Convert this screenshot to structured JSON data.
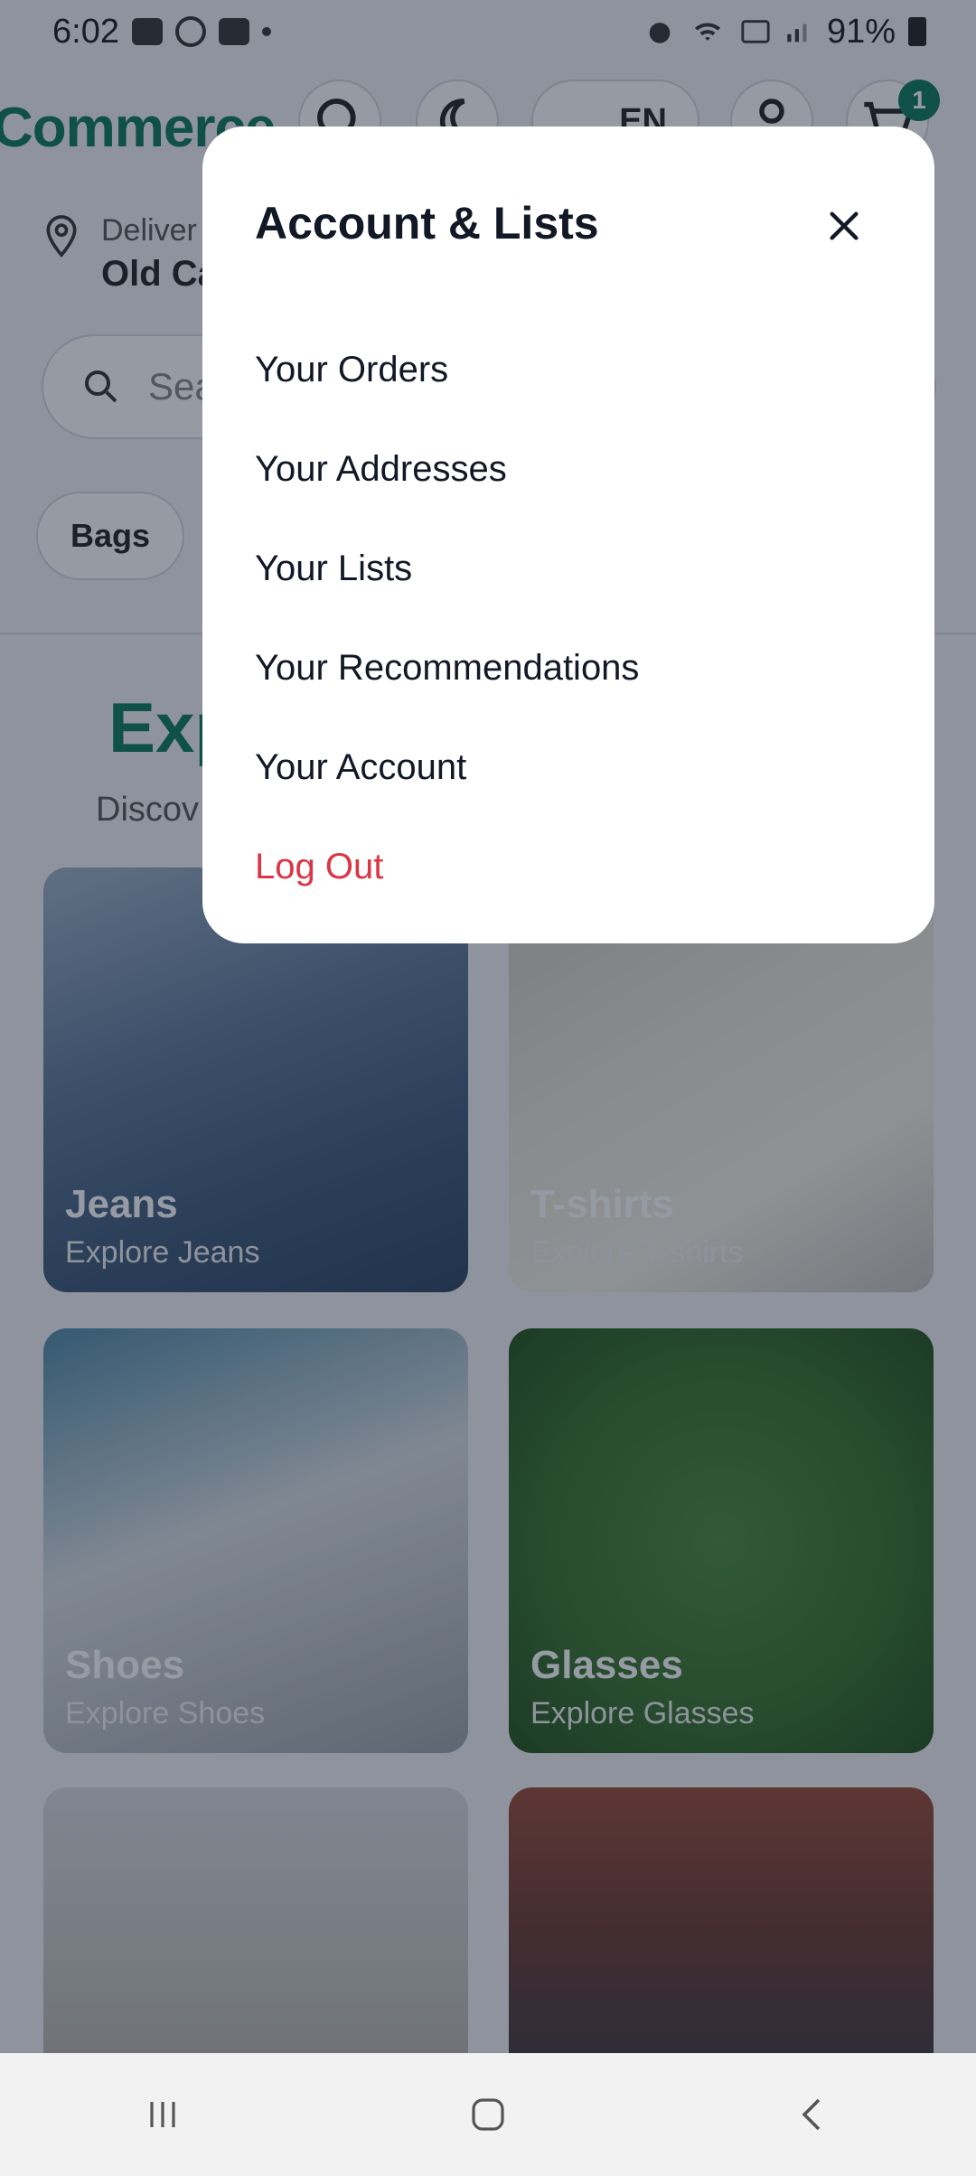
{
  "status_bar": {
    "time": "6:02",
    "battery": "91%",
    "icons": [
      "gallery-icon",
      "vpn-icon",
      "youtube-icon",
      "dot-icon",
      "alarm-icon",
      "wifi-icon",
      "volte-icon",
      "signal-icon",
      "battery-icon"
    ]
  },
  "header": {
    "brand": "Commerce",
    "language": "EN",
    "cart_count": "1",
    "icons": [
      "search-icon",
      "moon-icon",
      "globe-icon",
      "user-icon",
      "cart-icon"
    ]
  },
  "delivery": {
    "label": "Deliver",
    "location": "Old Ca"
  },
  "search": {
    "placeholder": "Sea"
  },
  "chips": [
    {
      "label": "Bags"
    }
  ],
  "explore": {
    "title": "Exp",
    "subtitle": "Discov"
  },
  "categories": [
    {
      "title": "Jeans",
      "subtitle": "Explore Jeans"
    },
    {
      "title": "T-shirts",
      "subtitle": "Explore T-shirts"
    },
    {
      "title": "Shoes",
      "subtitle": "Explore Shoes"
    },
    {
      "title": "Glasses",
      "subtitle": "Explore Glasses"
    }
  ],
  "modal": {
    "title": "Account & Lists",
    "items": [
      {
        "label": "Your Orders"
      },
      {
        "label": "Your Addresses"
      },
      {
        "label": "Your Lists"
      },
      {
        "label": "Your Recommendations"
      },
      {
        "label": "Your Account"
      },
      {
        "label": "Log Out"
      }
    ]
  },
  "colors": {
    "brand": "#0c7a5a",
    "logout": "#dc3545",
    "overlay": "rgba(20,30,50,0.45)"
  }
}
